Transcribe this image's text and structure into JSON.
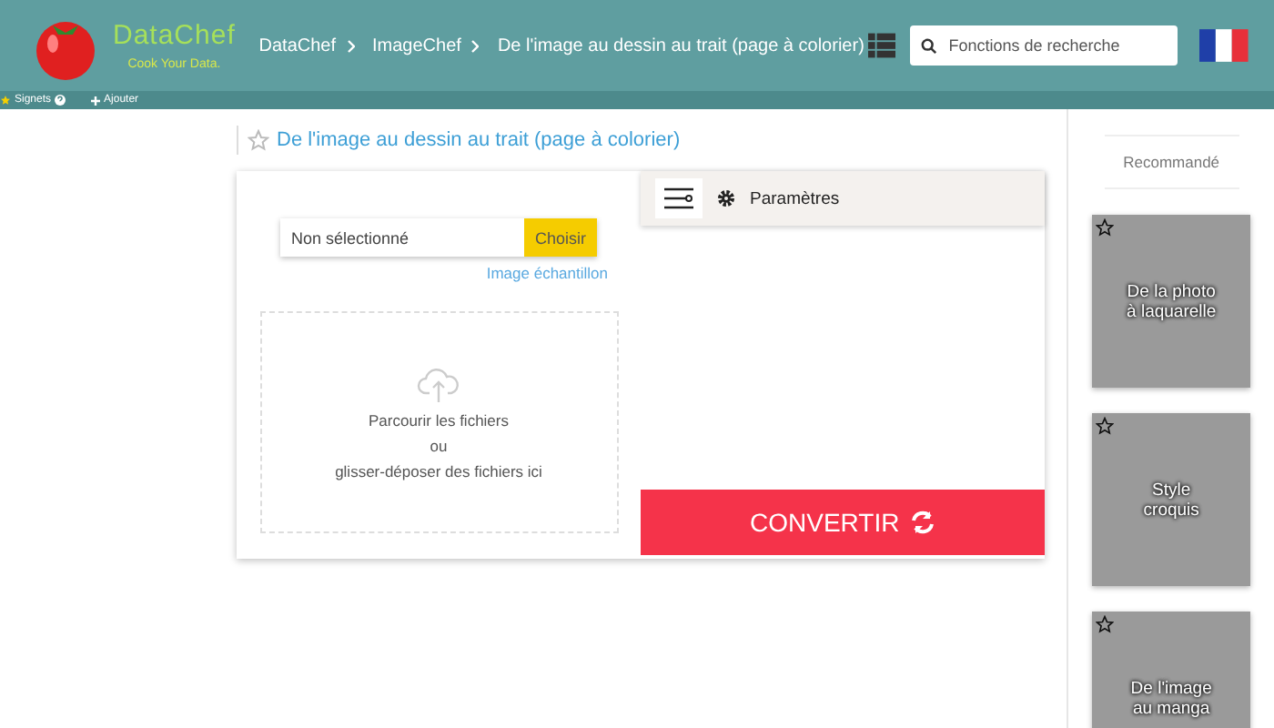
{
  "header": {
    "logo_title": "DataChef",
    "logo_tagline": "Cook Your Data.",
    "breadcrumbs": [
      "DataChef",
      "ImageChef",
      "De l'image au dessin au trait (page à colorier)"
    ],
    "search": {
      "placeholder": "Fonctions de recherche"
    }
  },
  "bookmark_bar": {
    "bookmarks": "Signets",
    "add": "Ajouter"
  },
  "page_title": "De l'image au dessin au trait (page à colorier)",
  "upload": {
    "file_field": "Non sélectionné",
    "choose_button": "Choisir",
    "sample_link": "Image échantillon",
    "drop_lines": [
      "Parcourir les fichiers",
      "ou",
      "glisser-déposer des fichiers ici"
    ]
  },
  "settings": {
    "label": "Paramètres"
  },
  "convert_button": "CONVERTIR",
  "sidebar": {
    "heading": "Recommandé",
    "cards": [
      {
        "label": "De la photo à laquarelle"
      },
      {
        "label": "Style croquis"
      },
      {
        "label": "De l'image au manga"
      }
    ]
  }
}
